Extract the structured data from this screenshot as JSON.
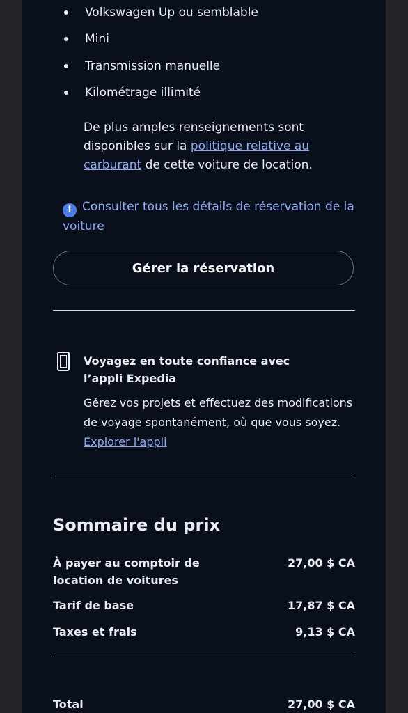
{
  "features": [
    "Volkswagen Up ou semblable",
    "Mini",
    "Transmission manuelle",
    "Kilométrage illimité"
  ],
  "fuel": {
    "prefix": "De plus amples renseignements sont disponibles sur la ",
    "link": "politique relative au carburant",
    "suffix": " de cette voiture de location."
  },
  "details_link": "Consulter tous les détails de réservation de la voiture",
  "manage_button": "Gérer la réservation",
  "app_promo": {
    "title": "Voyagez en toute confiance avec l’appli Expedia",
    "body": "Gérez vos projets et effectuez des modifications de voyage spontanément, où que vous soyez. ",
    "link": "Explorer l'appli"
  },
  "price_summary": {
    "title": "Sommaire du prix",
    "rows": [
      {
        "label": "À payer au comptoir de location de voitures",
        "value": "27,00 $ CA"
      },
      {
        "label": "Tarif de base",
        "value": "17,87 $ CA"
      },
      {
        "label": "Taxes et frais",
        "value": "9,13 $ CA"
      }
    ],
    "total_label": "Total",
    "total_value": "27,00 $ CA"
  }
}
